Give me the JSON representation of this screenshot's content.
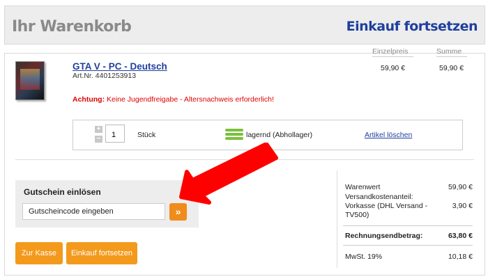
{
  "header": {
    "title": "Ihr Warenkorb",
    "continue_link": "Einkauf fortsetzen"
  },
  "columns": {
    "unit_price": "Einzelpreis",
    "total": "Summe"
  },
  "product": {
    "name": "GTA V - PC - Deutsch",
    "article_number": "Art.Nr. 4401253913",
    "unit_price": "59,90 €",
    "total": "59,90 €",
    "warning_label": "Achtung:",
    "warning_text": " Keine Jugendfreigabe - Altersnachweis erforderlich!",
    "quantity": "1",
    "unit": "Stück",
    "stock_status": "lagernd (Abhollager)",
    "stock_color": "#7ac13b",
    "delete_link": "Artikel löschen"
  },
  "coupon": {
    "title": "Gutschein einlösen",
    "value": "Gutscheincode eingeben",
    "submit_icon": "double-chevron-right-icon"
  },
  "buttons": {
    "checkout": "Zur Kasse",
    "continue": "Einkauf fortsetzen"
  },
  "summary": {
    "goods_label": "Warenwert",
    "goods_value": "59,90 €",
    "shipping_label_1": "Versandkostenanteil:",
    "shipping_label_2": "Vorkasse (DHL Versand -",
    "shipping_label_3": "TV500)",
    "shipping_value": "3,90 €",
    "total_label": "Rechnungsendbetrag:",
    "total_value": "63,80 €",
    "vat_label": "MwSt. 19%",
    "vat_value": "10,18 €"
  },
  "colors": {
    "accent_orange": "#f39a1c",
    "link_blue": "#1f3f9e",
    "warning_red": "#dd0000",
    "annotation_arrow": "#ff0000"
  }
}
